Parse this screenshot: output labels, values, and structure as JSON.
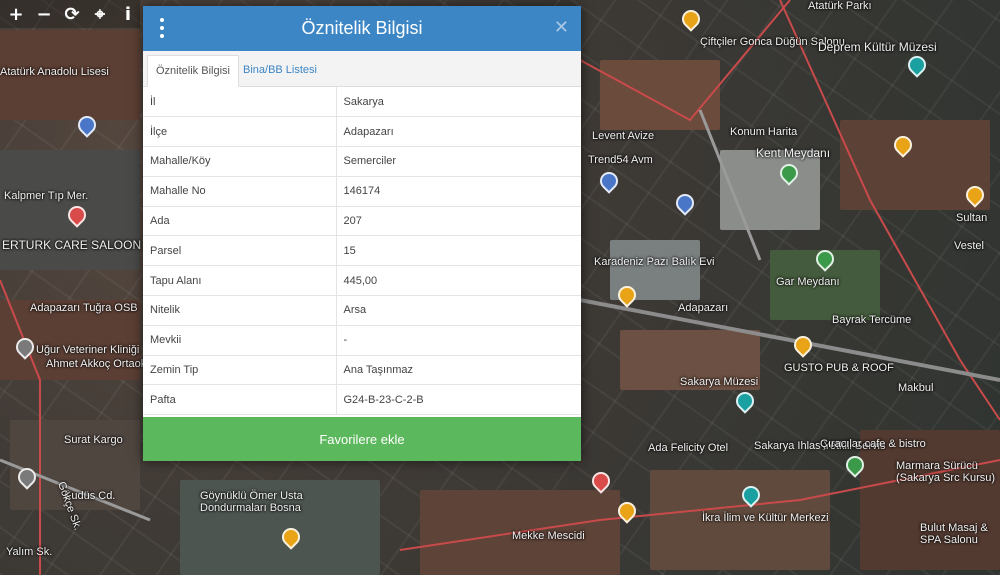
{
  "toolbar": {
    "zoom_in": "+",
    "zoom_out": "−",
    "refresh": "⟳",
    "locate": "⌖",
    "info": "i"
  },
  "map": {
    "labels": [
      "Atatürk Parkı",
      "Çiftçiler Gonca\nDüğün Salonu",
      "Deprem Kültür Müzesi",
      "Atatürk Anadolu Lisesi",
      "Levent Avize",
      "Trend54 Avm",
      "Konum Harita",
      "Kent Meydanı",
      "Kalpmer Tıp Mer.",
      "ERTURK CARE SALOON",
      "Adapazarı Tuğra OSB",
      "Uğur Veteriner Kliniği",
      "Ahmet Akkoç Ortaokulu",
      "Surat Kargo",
      "Kudüs Cd.",
      "Karadeniz Pazı Balık Evi",
      "Gar Meydanı",
      "Bayrak Tercüme",
      "Sakarya Müzesi",
      "GUSTO PUB & ROOF",
      "Adapazarı",
      "Göynüklü Ömer Usta\nDondurmaları Bosna",
      "Ada Felicity Otel",
      "Sakarya Ihlas Yetkili Servis",
      "Çıracılar cafe & bistro",
      "Marmara Sürücü\n(Sakarya Src Kursu)",
      "İkra İlim ve Kültür Merkezi",
      "Mekke Mescidi",
      "Bulut Masaj &\nSPA Salonu",
      "Sultan",
      "Vestel",
      "Makbul",
      "Yalım Sk.",
      "Gökçe Sk."
    ]
  },
  "dialog": {
    "title": "Öznitelik Bilgisi",
    "menu_icon": "more-vertical-icon",
    "close_symbol": "✕",
    "tabs": [
      {
        "label": "Öznitelik Bilgisi",
        "active": true
      },
      {
        "label": "Bina/BB Listesi",
        "active": false
      }
    ],
    "rows": [
      {
        "key": "İl",
        "value": "Sakarya"
      },
      {
        "key": "İlçe",
        "value": "Adapazarı"
      },
      {
        "key": "Mahalle/Köy",
        "value": "Semerciler"
      },
      {
        "key": "Mahalle No",
        "value": "146174"
      },
      {
        "key": "Ada",
        "value": "207"
      },
      {
        "key": "Parsel",
        "value": "15"
      },
      {
        "key": "Tapu Alanı",
        "value": "445,00"
      },
      {
        "key": "Nitelik",
        "value": "Arsa"
      },
      {
        "key": "Mevkii",
        "value": "-"
      },
      {
        "key": "Zemin Tip",
        "value": "Ana Taşınmaz"
      },
      {
        "key": "Pafta",
        "value": "G24-B-23-C-2-B"
      }
    ],
    "action_label": "Favorilere ekle"
  },
  "colors": {
    "header": "#3c86c6",
    "action": "#5cb85c",
    "tab_link": "#3c86c6"
  }
}
